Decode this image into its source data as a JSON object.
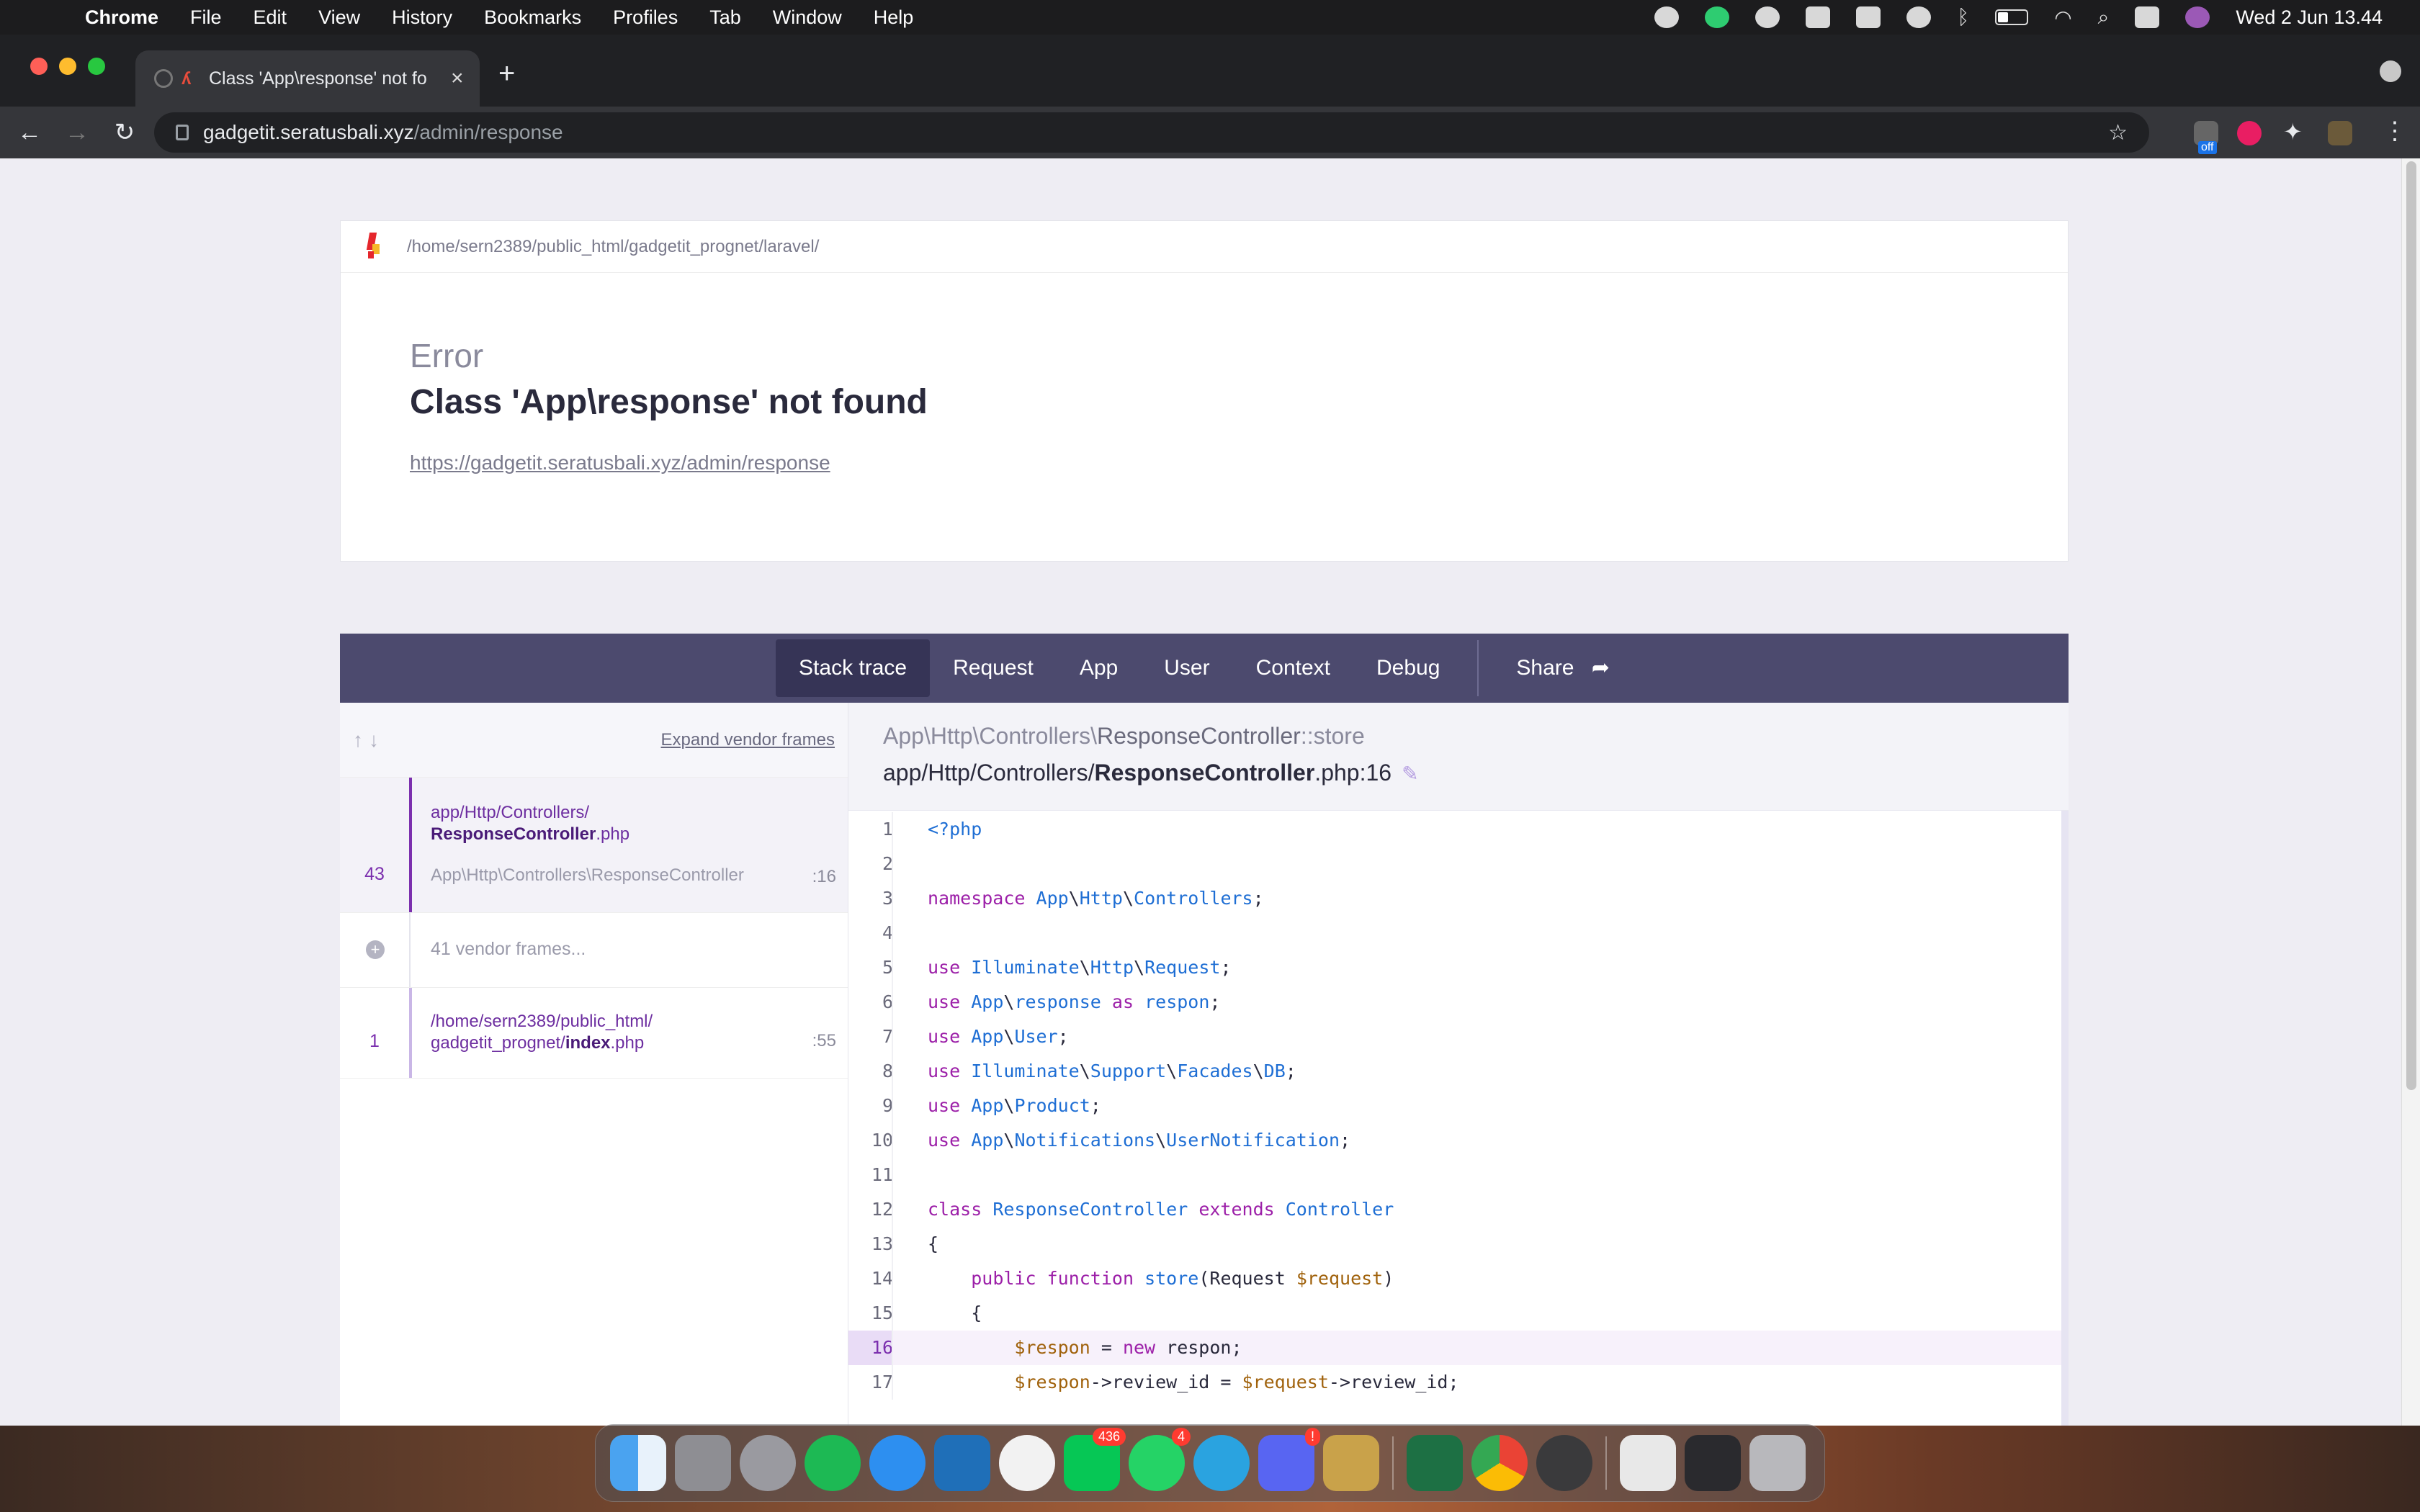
{
  "menubar": {
    "app_name": "Chrome",
    "items": [
      "File",
      "Edit",
      "View",
      "History",
      "Bookmarks",
      "Profiles",
      "Tab",
      "Window",
      "Help"
    ],
    "clock": "Wed 2 Jun  13.44"
  },
  "browser": {
    "tab_title": "Class 'App\\response' not fo",
    "url_host": "gadgetit.seratusbali.xyz",
    "url_path": "/admin/response",
    "extension_badge": "off"
  },
  "error": {
    "app_path": "/home/sern2389/public_html/gadgetit_prognet/laravel/",
    "type": "Error",
    "message": "Class 'App\\response' not found",
    "url": "https://gadgetit.seratusbali.xyz/admin/response"
  },
  "tabs": [
    "Stack trace",
    "Request",
    "App",
    "User",
    "Context",
    "Debug"
  ],
  "share_label": "Share",
  "stack": {
    "expand_label": "Expand vendor frames",
    "frames": [
      {
        "num": "43",
        "file_dir": "app/Http/Controllers/",
        "file_name": "ResponseController",
        "file_ext": ".php",
        "class": "App\\Http\\Controllers\\ResponseController",
        "line": ":16"
      },
      {
        "num": "1",
        "file_dir": "/home/sern2389/public_html/",
        "file_dir2": "gadgetit_prognet/",
        "file_name": "index",
        "file_ext": ".php",
        "line": ":55"
      }
    ],
    "vendor_label": "41 vendor frames..."
  },
  "code": {
    "class_prefix": "App\\Http\\Controllers\\",
    "class_name": "ResponseController",
    "method": "::store",
    "file_prefix": "app/Http/Controllers/",
    "file_name": "ResponseController",
    "file_suffix": ".php:16",
    "highlight_line": 16
  },
  "dock": {
    "badges": {
      "line": "436",
      "whatsapp": "4",
      "discord": "!"
    }
  },
  "colors": {
    "tab_bar": "#4c4a6e",
    "active_tab": "#363456",
    "accent_purple": "#7b2fae",
    "keyword": "#9c1fa8",
    "namespace": "#1e6ed4",
    "variable": "#a0620c"
  }
}
